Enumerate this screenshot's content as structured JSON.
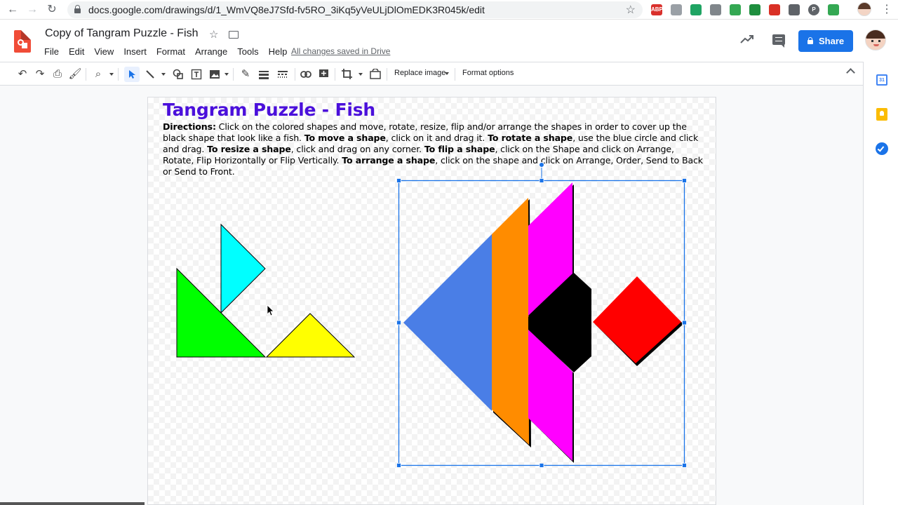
{
  "browser": {
    "url": "docs.google.com/drawings/d/1_WmVQ8eJ7Sfd-fv5RO_3iKq5yVeULjDlOmEDK3R045k/edit",
    "extensions": [
      {
        "name": "adblock-icon",
        "label": "ABP",
        "color": "#d9302c"
      },
      {
        "name": "extension-icon-2",
        "label": "",
        "color": "#9aa0a6"
      },
      {
        "name": "google-drive-icon",
        "label": "",
        "color": "#1fa463"
      },
      {
        "name": "screenshot-icon",
        "label": "",
        "color": "#80868b"
      },
      {
        "name": "extension-icon-5",
        "label": "",
        "color": "#34a853"
      },
      {
        "name": "google-classroom-icon",
        "label": "",
        "color": "#1e8e3e"
      },
      {
        "name": "extension-icon-7",
        "label": "",
        "color": "#d93025"
      },
      {
        "name": "pocket-icon",
        "label": "",
        "color": "#5f6368"
      },
      {
        "name": "pinterest-icon",
        "label": "P",
        "color": "#5f6368"
      },
      {
        "name": "extension-icon-10",
        "label": "",
        "color": "#34a853"
      }
    ]
  },
  "header": {
    "doc_title": "Copy of Tangram Puzzle - Fish",
    "menu": [
      "File",
      "Edit",
      "View",
      "Insert",
      "Format",
      "Arrange",
      "Tools",
      "Help"
    ],
    "save_status": "All changes saved in Drive",
    "share_label": "Share"
  },
  "toolbar": {
    "replace_image_label": "Replace image",
    "format_options_label": "Format options"
  },
  "side_panel": {
    "calendar_label": "31"
  },
  "canvas": {
    "title": "Tangram Puzzle - Fish",
    "directions_segments": [
      {
        "text": "Directions:",
        "bold": true
      },
      {
        "text": " Click on the colored shapes and move, rotate, resize, flip and/or arrange the shapes in order to cover up the black shape that look like a fish.  ",
        "bold": false
      },
      {
        "text": "To move a shape",
        "bold": true
      },
      {
        "text": ", click on it and drag it.  ",
        "bold": false
      },
      {
        "text": "To rotate a shape",
        "bold": true
      },
      {
        "text": ", use the blue circle and click and drag. ",
        "bold": false
      },
      {
        "text": "To resize a shape",
        "bold": true
      },
      {
        "text": ", click and drag on any corner. ",
        "bold": false
      },
      {
        "text": "To flip a shape",
        "bold": true
      },
      {
        "text": ", click on the Shape and click on Arrange, Rotate, Flip Horizontally or Flip Vertically. ",
        "bold": false
      },
      {
        "text": "To arrange a shape",
        "bold": true
      },
      {
        "text": ", click on the shape and click on Arrange, Order, Send to Back or Send to Front.",
        "bold": false
      }
    ],
    "colors": {
      "title": "#4a0fdb",
      "blue": "#4a7ee6",
      "orange": "#ff8c00",
      "magenta": "#ff00ff",
      "black": "#000000",
      "red": "#ff0000",
      "cyan": "#00ffff",
      "green": "#00ff00",
      "yellow": "#ffff00",
      "selection": "#1a73e8"
    }
  }
}
